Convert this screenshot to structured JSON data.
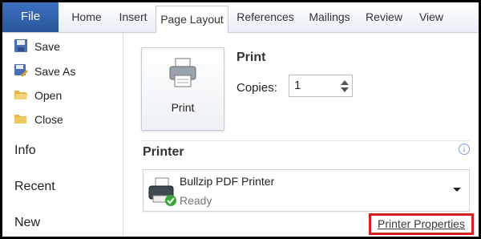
{
  "ribbon": {
    "file_label": "File",
    "tabs": [
      {
        "label": "Home"
      },
      {
        "label": "Insert"
      },
      {
        "label": "Page Layout"
      },
      {
        "label": "References"
      },
      {
        "label": "Mailings"
      },
      {
        "label": "Review"
      },
      {
        "label": "View"
      }
    ],
    "active_tab": "Page Layout"
  },
  "nav": {
    "items": [
      {
        "label": "Save",
        "icon": "save-icon"
      },
      {
        "label": "Save As",
        "icon": "save-as-icon"
      },
      {
        "label": "Open",
        "icon": "open-folder-icon"
      },
      {
        "label": "Close",
        "icon": "close-folder-icon"
      }
    ],
    "sections": [
      {
        "label": "Info"
      },
      {
        "label": "Recent"
      },
      {
        "label": "New"
      }
    ]
  },
  "print": {
    "heading": "Print",
    "button_label": "Print",
    "copies_label": "Copies:",
    "copies_value": "1"
  },
  "printer": {
    "heading": "Printer",
    "name": "Bullzip PDF Printer",
    "status": "Ready",
    "properties_link": "Printer Properties",
    "info_glyph": "i"
  },
  "colors": {
    "file_tab": "#2a579a",
    "highlight_border": "#d21f1f",
    "ready_check": "#3aa53a"
  }
}
